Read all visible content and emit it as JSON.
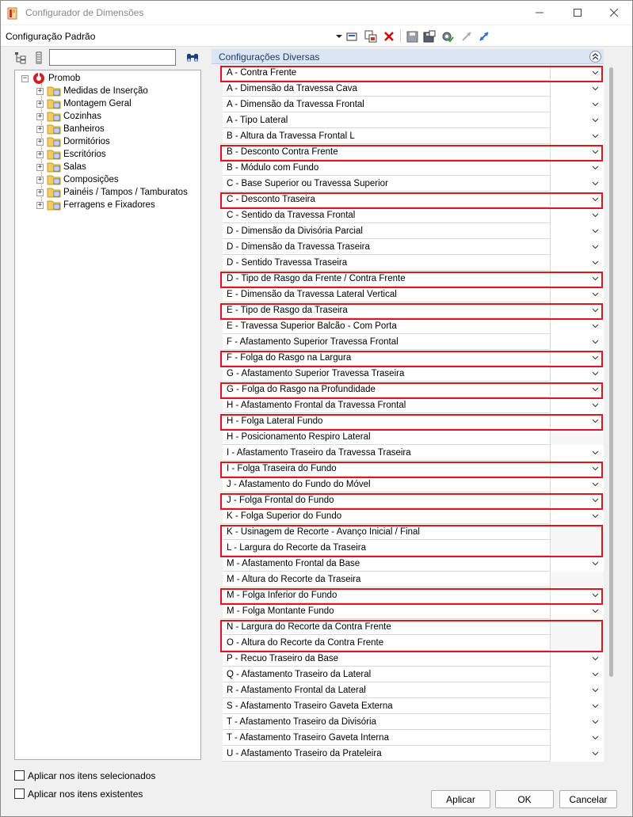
{
  "window": {
    "title": "Configurador de Dimensões",
    "minimize_icon": "minimize-icon",
    "maximize_icon": "maximize-icon",
    "close_icon": "close-icon"
  },
  "toolbar": {
    "config_label": "Configuração Padrão",
    "icons": [
      "dropdown-arrow-icon",
      "apply-icon",
      "copy-icon",
      "delete-icon",
      "save-icon",
      "save-as-icon",
      "settings-icon",
      "expand-icon",
      "collapse-icon"
    ]
  },
  "left": {
    "search_value": "",
    "tree_root": "Promob",
    "tree_items": [
      "Medidas de Inserção",
      "Montagem Geral",
      "Cozinhas",
      "Banheiros",
      "Dormitórios",
      "Escritórios",
      "Salas",
      "Composições",
      "Painéis / Tampos / Tamburatos",
      "Ferragens e Fixadores"
    ]
  },
  "right": {
    "section_title": "Configurações Diversas",
    "rows": [
      {
        "label": "A - Contra Frente",
        "dropdown": true,
        "highlight": true
      },
      {
        "label": "A - Dimensão da Travessa Cava",
        "dropdown": true,
        "highlight": false
      },
      {
        "label": "A - Dimensão da Travessa Frontal",
        "dropdown": true,
        "highlight": false
      },
      {
        "label": "A - Tipo Lateral",
        "dropdown": true,
        "highlight": false
      },
      {
        "label": "B - Altura da Travessa Frontal L",
        "dropdown": true,
        "highlight": false
      },
      {
        "label": "B - Desconto Contra Frente",
        "dropdown": true,
        "highlight": true
      },
      {
        "label": "B - Módulo com Fundo",
        "dropdown": true,
        "highlight": false
      },
      {
        "label": "C - Base Superior ou Travessa Superior",
        "dropdown": true,
        "highlight": false
      },
      {
        "label": "C - Desconto Traseira",
        "dropdown": true,
        "highlight": true
      },
      {
        "label": "C - Sentido da Travessa Frontal",
        "dropdown": true,
        "highlight": false
      },
      {
        "label": "D - Dimensão da Divisória Parcial",
        "dropdown": true,
        "highlight": false
      },
      {
        "label": "D - Dimensão da Travessa Traseira",
        "dropdown": true,
        "highlight": false
      },
      {
        "label": "D - Sentido Travessa Traseira",
        "dropdown": true,
        "highlight": false
      },
      {
        "label": "D - Tipo de Rasgo da Frente / Contra Frente",
        "dropdown": true,
        "highlight": true
      },
      {
        "label": "E - Dimensão da Travessa Lateral Vertical",
        "dropdown": true,
        "highlight": false
      },
      {
        "label": "E - Tipo de Rasgo da Traseira",
        "dropdown": true,
        "highlight": true
      },
      {
        "label": "E - Travessa Superior Balcão - Com Porta",
        "dropdown": true,
        "highlight": false
      },
      {
        "label": "F - Afastamento Superior Travessa Frontal",
        "dropdown": true,
        "highlight": false
      },
      {
        "label": "F - Folga do Rasgo na Largura",
        "dropdown": true,
        "highlight": true
      },
      {
        "label": "G - Afastamento Superior Travessa Traseira",
        "dropdown": true,
        "highlight": false
      },
      {
        "label": "G - Folga do Rasgo na Profundidade",
        "dropdown": true,
        "highlight": true
      },
      {
        "label": "H - Afastamento Frontal da Travessa Frontal",
        "dropdown": true,
        "highlight": false
      },
      {
        "label": "H - Folga Lateral Fundo",
        "dropdown": true,
        "highlight": true
      },
      {
        "label": "H - Posicionamento Respiro Lateral",
        "dropdown": false,
        "highlight": false
      },
      {
        "label": "I - Afastamento Traseiro da Travessa Traseira",
        "dropdown": true,
        "highlight": false
      },
      {
        "label": "I - Folga Traseira do Fundo",
        "dropdown": true,
        "highlight": true
      },
      {
        "label": "J - Afastamento do Fundo do Móvel",
        "dropdown": true,
        "highlight": false
      },
      {
        "label": "J - Folga Frontal do Fundo",
        "dropdown": true,
        "highlight": true
      },
      {
        "label": "K - Folga Superior do Fundo",
        "dropdown": true,
        "highlight": false
      },
      {
        "label": "K - Usinagem de Recorte - Avanço Inicial / Final",
        "dropdown": false,
        "highlight": true
      },
      {
        "label": "L - Largura do Recorte da Traseira",
        "dropdown": false,
        "highlight": true
      },
      {
        "label": "M - Afastamento Frontal da Base",
        "dropdown": true,
        "highlight": false
      },
      {
        "label": "M - Altura do Recorte da Traseira",
        "dropdown": false,
        "highlight": false
      },
      {
        "label": "M - Folga Inferior do Fundo",
        "dropdown": true,
        "highlight": true
      },
      {
        "label": "M - Folga Montante Fundo",
        "dropdown": true,
        "highlight": false
      },
      {
        "label": "N - Largura do Recorte da Contra Frente",
        "dropdown": false,
        "highlight": true
      },
      {
        "label": "O - Altura do Recorte da Contra Frente",
        "dropdown": false,
        "highlight": true
      },
      {
        "label": "P - Recuo Traseiro da Base",
        "dropdown": true,
        "highlight": false
      },
      {
        "label": "Q - Afastamento Traseiro da Lateral",
        "dropdown": true,
        "highlight": false
      },
      {
        "label": "R - Afastamento Frontal da Lateral",
        "dropdown": true,
        "highlight": false
      },
      {
        "label": "S - Afastamento Traseiro Gaveta Externa",
        "dropdown": true,
        "highlight": false
      },
      {
        "label": "T - Afastamento Traseiro da Divisória",
        "dropdown": true,
        "highlight": false
      },
      {
        "label": "T - Afastamento Traseiro Gaveta Interna",
        "dropdown": true,
        "highlight": false
      },
      {
        "label": "U - Afastamento Traseiro da Prateleira",
        "dropdown": true,
        "highlight": false
      }
    ]
  },
  "footer": {
    "apply_selected_label": "Aplicar nos itens selecionados",
    "apply_existing_label": "Aplicar nos itens existentes",
    "apply_button": "Aplicar",
    "ok_button": "OK",
    "cancel_button": "Cancelar"
  },
  "colors": {
    "highlight": "#e2141d",
    "section_header_bg": "#dbe5f3",
    "delete_red": "#d40000"
  }
}
